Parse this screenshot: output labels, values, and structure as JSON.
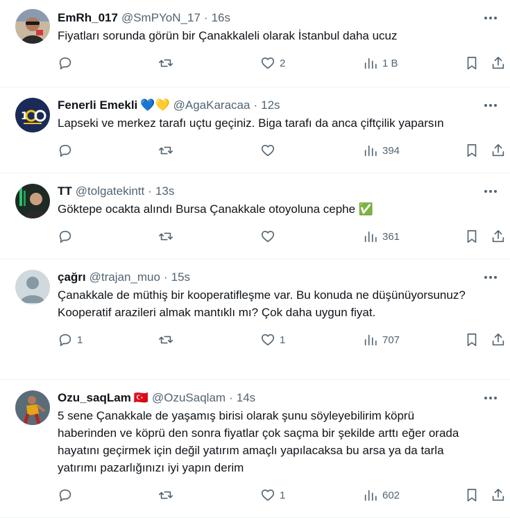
{
  "colors": {
    "text": "#0f1419",
    "secondary": "#536471",
    "divider": "#eff3f4"
  },
  "tweets": [
    {
      "name": "EmRh_017",
      "handle": "@SmPYoN_17",
      "sep": "·",
      "time": "16s",
      "text": "Fiyatları sorunda görün bir Çanakkaleli olarak İstanbul daha ucuz",
      "reply_count": "",
      "retweet_count": "",
      "like_count": "2",
      "view_count": "1 B"
    },
    {
      "name": "Fenerli Emekli",
      "emoji": "💙💛",
      "handle": "@AgaKaracaa",
      "sep": "·",
      "time": "12s",
      "text": "Lapseki ve merkez tarafı uçtu geçiniz. Biga tarafı da anca çiftçilik yaparsın",
      "reply_count": "",
      "retweet_count": "",
      "like_count": "",
      "view_count": "394"
    },
    {
      "name": "TT",
      "handle": "@tolgatekintt",
      "sep": "·",
      "time": "13s",
      "text": "Göktepe ocakta alındı Bursa Çanakkale otoyoluna cephe ✅",
      "reply_count": "",
      "retweet_count": "",
      "like_count": "",
      "view_count": "361"
    },
    {
      "name": "çağrı",
      "handle": "@trajan_muo",
      "sep": "·",
      "time": "15s",
      "text": "Çanakkale de müthiş bir kooperatifleşme var. Bu konuda ne düşünüyorsunuz? Kooperatif arazileri almak mantıklı mı? Çok daha uygun fiyat.",
      "reply_count": "1",
      "retweet_count": "",
      "like_count": "1",
      "view_count": "707"
    },
    {
      "name": "Ozu_saqLam",
      "emoji": "🇹🇷",
      "handle": "@OzuSaqlam",
      "sep": "·",
      "time": "14s",
      "text": "5 sene Çanakkale de yaşamış birisi olarak şunu söyleyebilirim köprü haberinden ve köprü den sonra fiyatlar çok saçma bir  şekilde arttı eğer orada hayatını geçirmek için değil yatırım amaçlı yapılacaksa bu arsa ya da tarla yatırımı pazarlığınızı iyi yapın derim",
      "reply_count": "",
      "retweet_count": "",
      "like_count": "1",
      "view_count": "602"
    }
  ]
}
